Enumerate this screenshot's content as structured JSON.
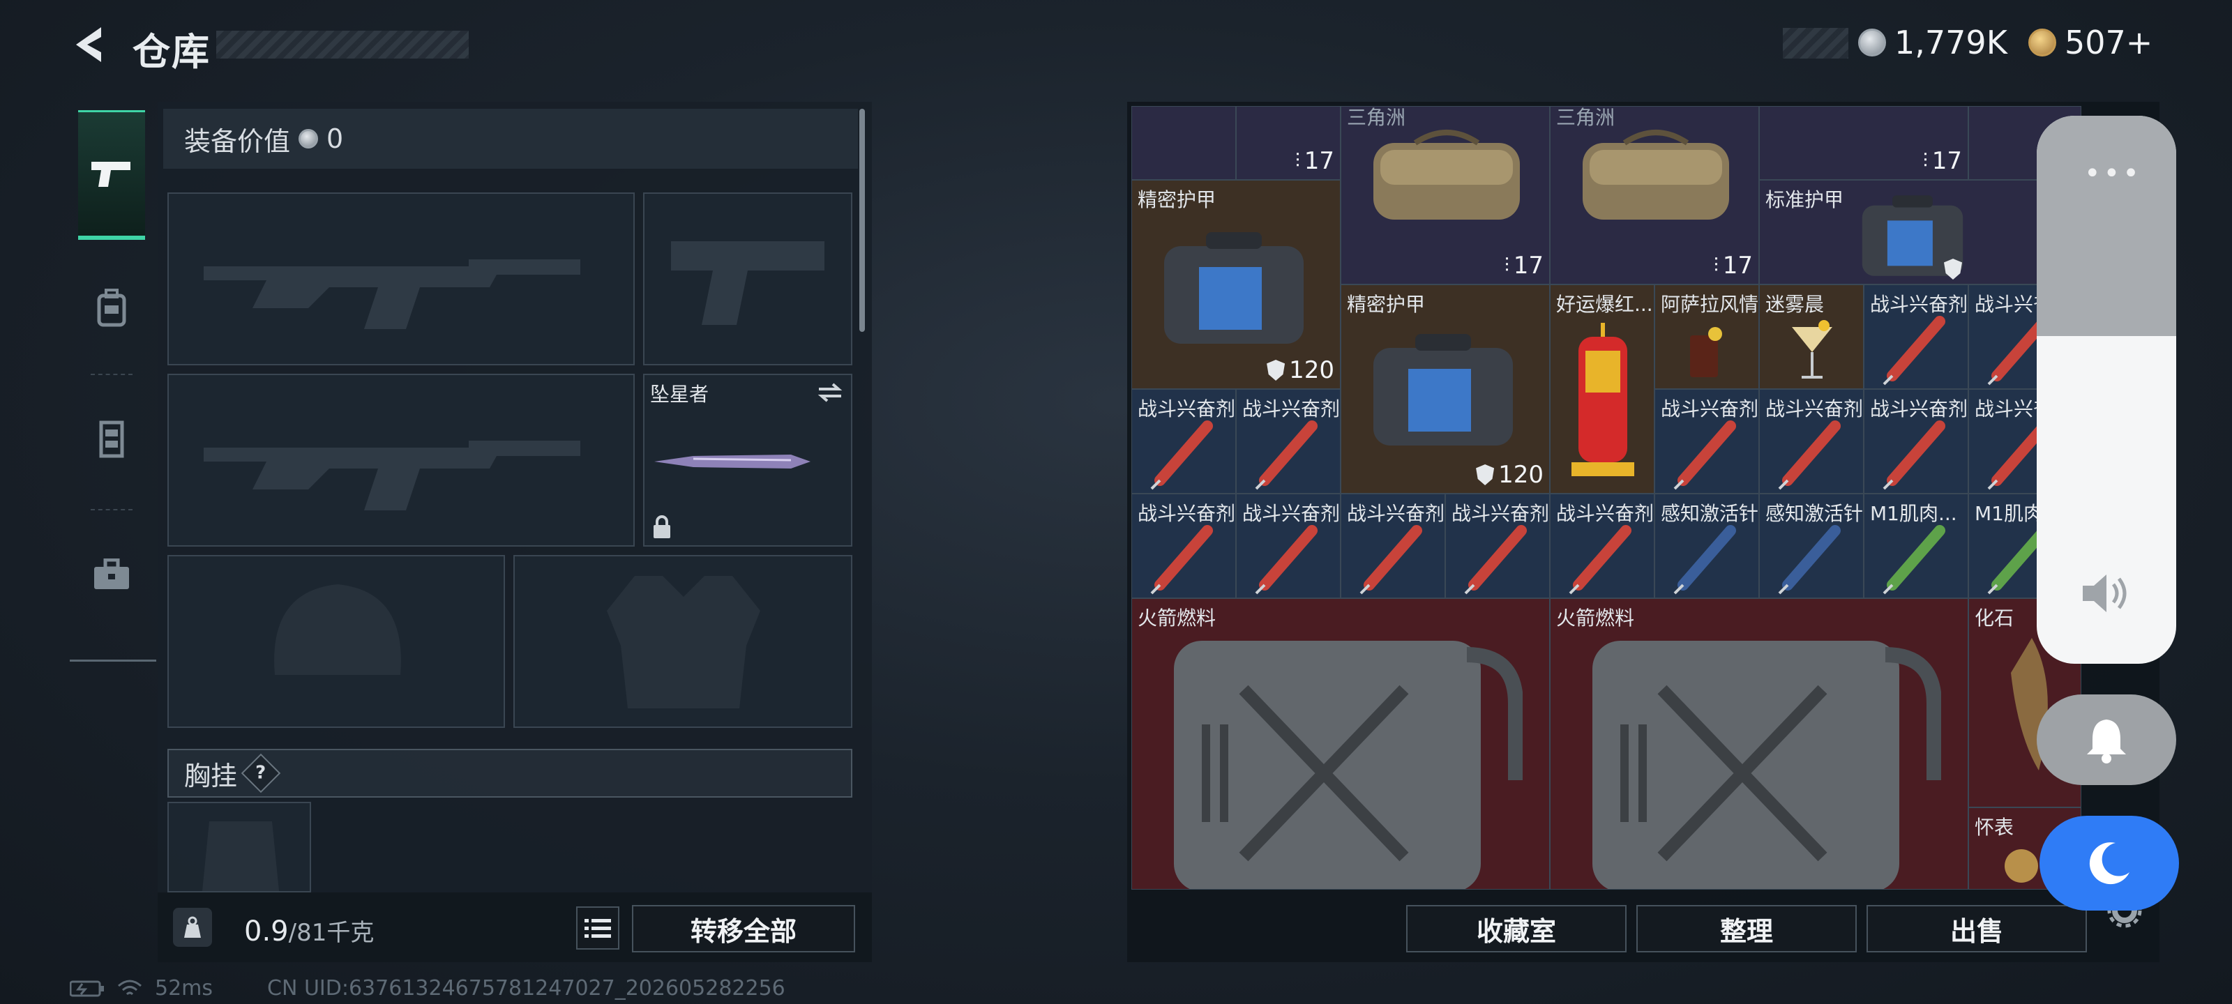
{
  "header": {
    "title": "仓库",
    "back_icon": "back-arrow-icon"
  },
  "currency": {
    "silver": "1,779K",
    "gold": "507+"
  },
  "tabs": [
    {
      "icon": "pistol-icon",
      "active": true
    },
    {
      "icon": "backpack-icon",
      "active": false
    },
    {
      "icon": "vest-icon",
      "active": false
    },
    {
      "icon": "case-icon",
      "active": false
    }
  ],
  "equipment": {
    "value_label": "装备价值",
    "value": "0",
    "melee_name": "坠星者",
    "chest_rig_label": "胸挂",
    "help": "?"
  },
  "capacity": {
    "current": "0.9",
    "max": "/81千克"
  },
  "buttons": {
    "transfer_all": "转移全部",
    "collection": "收藏室",
    "organize": "整理",
    "sell": "出售"
  },
  "grid": {
    "row0": {
      "bullet1": "17",
      "bullet2": "17",
      "ammo_label": "三角洲",
      "ammo_label2": "三角洲",
      "bullet3": "17",
      "bullet4": "17"
    },
    "armor1": {
      "name": "精密护甲",
      "durability": "120"
    },
    "armor2": {
      "name": "精密护甲",
      "durability": "120"
    },
    "armor3": {
      "name": "标准护甲"
    },
    "lucky": "好运爆红...",
    "drink": "阿萨拉风情",
    "mist": "迷雾晨",
    "stim": "战斗兴奋剂",
    "sense": "感知激活针",
    "m1": "M1肌肉...",
    "m1b": "M1肌肉",
    "fuel": "火箭燃料",
    "fossil": "化石",
    "watch": "怀表"
  },
  "status": {
    "ping": "52ms",
    "uid": "CN UID:63761324675781247027_202605282256"
  },
  "colors": {
    "accent": "#3fd4a6",
    "moon": "#2f7cf6"
  }
}
